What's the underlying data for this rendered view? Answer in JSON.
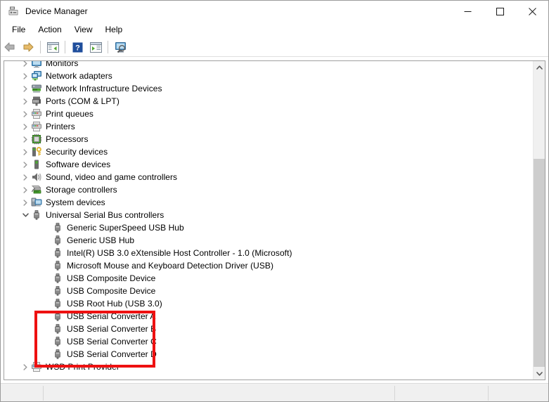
{
  "window": {
    "title": "Device Manager",
    "app_icon": "device-manager-icon",
    "controls": {
      "minimize": "minimize-icon",
      "maximize": "maximize-icon",
      "close": "close-icon"
    }
  },
  "menubar": {
    "items": [
      {
        "label": "File"
      },
      {
        "label": "Action"
      },
      {
        "label": "View"
      },
      {
        "label": "Help"
      }
    ]
  },
  "toolbar": {
    "buttons": [
      {
        "name": "back-button",
        "icon": "back-arrow-icon"
      },
      {
        "name": "forward-button",
        "icon": "forward-arrow-icon"
      },
      {
        "name": "show-hide-console-tree",
        "icon": "console-tree-icon"
      },
      {
        "name": "help-button",
        "icon": "question-mark-icon"
      },
      {
        "name": "properties-button",
        "icon": "properties-icon"
      },
      {
        "name": "scan-hardware-changes",
        "icon": "scan-monitor-icon"
      }
    ]
  },
  "tree": {
    "items": [
      {
        "label": "Monitors",
        "icon": "monitor-icon",
        "level": 1,
        "state": "collapsed"
      },
      {
        "label": "Network adapters",
        "icon": "network-adapter-icon",
        "level": 1,
        "state": "collapsed"
      },
      {
        "label": "Network Infrastructure Devices",
        "icon": "network-infra-icon",
        "level": 1,
        "state": "collapsed"
      },
      {
        "label": "Ports (COM & LPT)",
        "icon": "port-icon",
        "level": 1,
        "state": "collapsed"
      },
      {
        "label": "Print queues",
        "icon": "printer-icon",
        "level": 1,
        "state": "collapsed"
      },
      {
        "label": "Printers",
        "icon": "printer-icon",
        "level": 1,
        "state": "collapsed"
      },
      {
        "label": "Processors",
        "icon": "processor-icon",
        "level": 1,
        "state": "collapsed"
      },
      {
        "label": "Security devices",
        "icon": "security-device-icon",
        "level": 1,
        "state": "collapsed"
      },
      {
        "label": "Software devices",
        "icon": "software-device-icon",
        "level": 1,
        "state": "collapsed"
      },
      {
        "label": "Sound, video and game controllers",
        "icon": "sound-icon",
        "level": 1,
        "state": "collapsed"
      },
      {
        "label": "Storage controllers",
        "icon": "storage-controller-icon",
        "level": 1,
        "state": "collapsed"
      },
      {
        "label": "System devices",
        "icon": "system-device-icon",
        "level": 1,
        "state": "collapsed"
      },
      {
        "label": "Universal Serial Bus controllers",
        "icon": "usb-icon",
        "level": 1,
        "state": "expanded"
      },
      {
        "label": "Generic SuperSpeed USB Hub",
        "icon": "usb-icon",
        "level": 2,
        "state": "leaf"
      },
      {
        "label": "Generic USB Hub",
        "icon": "usb-icon",
        "level": 2,
        "state": "leaf"
      },
      {
        "label": "Intel(R) USB 3.0 eXtensible Host Controller - 1.0 (Microsoft)",
        "icon": "usb-icon",
        "level": 2,
        "state": "leaf"
      },
      {
        "label": "Microsoft Mouse and Keyboard Detection Driver (USB)",
        "icon": "usb-icon",
        "level": 2,
        "state": "leaf"
      },
      {
        "label": "USB Composite Device",
        "icon": "usb-icon",
        "level": 2,
        "state": "leaf"
      },
      {
        "label": "USB Composite Device",
        "icon": "usb-icon",
        "level": 2,
        "state": "leaf"
      },
      {
        "label": "USB Root Hub (USB 3.0)",
        "icon": "usb-icon",
        "level": 2,
        "state": "leaf"
      },
      {
        "label": "USB Serial Converter A",
        "icon": "usb-icon",
        "level": 2,
        "state": "leaf"
      },
      {
        "label": "USB Serial Converter B",
        "icon": "usb-icon",
        "level": 2,
        "state": "leaf"
      },
      {
        "label": "USB Serial Converter C",
        "icon": "usb-icon",
        "level": 2,
        "state": "leaf"
      },
      {
        "label": "USB Serial Converter D",
        "icon": "usb-icon",
        "level": 2,
        "state": "leaf"
      },
      {
        "label": "WSD Print Provider",
        "icon": "printer-icon",
        "level": 1,
        "state": "collapsed"
      }
    ]
  },
  "annotation": {
    "color": "#ee1111",
    "highlights": [
      "USB Serial Converter A",
      "USB Serial Converter B",
      "USB Serial Converter C",
      "USB Serial Converter D"
    ]
  },
  "scrollbar": {
    "up_icon": "chevron-up-icon",
    "down_icon": "chevron-down-icon"
  },
  "statusbar": {
    "left_text": "",
    "middle_text": "",
    "right_text": ""
  }
}
